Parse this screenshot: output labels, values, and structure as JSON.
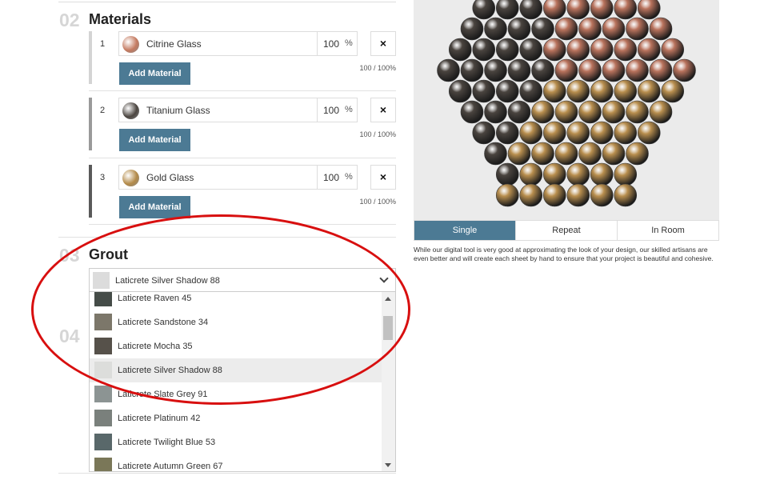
{
  "materials_section": {
    "number": "02",
    "title": "Materials",
    "rows": [
      {
        "index": "1",
        "name": "Citrine Glass",
        "percent": "100",
        "pct_symbol": "%",
        "remove": "×",
        "add_label": "Add Material",
        "total": "100 / 100%",
        "bar_color": "#d4d4d4",
        "swatch_color": "#c47a60"
      },
      {
        "index": "2",
        "name": "Titanium Glass",
        "percent": "100",
        "pct_symbol": "%",
        "remove": "×",
        "add_label": "Add Material",
        "total": "100 / 100%",
        "bar_color": "#9a9a9a",
        "swatch_color": "#4b4540"
      },
      {
        "index": "3",
        "name": "Gold Glass",
        "percent": "100",
        "pct_symbol": "%",
        "remove": "×",
        "add_label": "Add Material",
        "total": "100 / 100%",
        "bar_color": "#5a5a5a",
        "swatch_color": "#b38a48"
      }
    ]
  },
  "grout_section": {
    "number": "03",
    "title": "Grout",
    "selected": {
      "name": "Laticrete Silver Shadow 88",
      "color": "#dcdcdc"
    },
    "options": [
      {
        "name": "Laticrete Raven 45",
        "color": "#454c48",
        "selected": false
      },
      {
        "name": "Laticrete Sandstone 34",
        "color": "#7c776a",
        "selected": false
      },
      {
        "name": "Laticrete Mocha 35",
        "color": "#56514a",
        "selected": false
      },
      {
        "name": "Laticrete Silver Shadow 88",
        "color": "#dcdddb",
        "selected": true
      },
      {
        "name": "Laticrete Slate Grey 91",
        "color": "#8c9493",
        "selected": false
      },
      {
        "name": "Laticrete Platinum 42",
        "color": "#7a807c",
        "selected": false
      },
      {
        "name": "Laticrete Twilight Blue 53",
        "color": "#59686a",
        "selected": false
      },
      {
        "name": "Laticrete Autumn Green 67",
        "color": "#7a7758",
        "selected": false
      }
    ]
  },
  "next_section": {
    "number": "04"
  },
  "preview": {
    "background": "#ebebeb",
    "tile_colors": {
      "copper": "#b9735d",
      "titanium": "#4a443f",
      "gold": "#b98f4f"
    }
  },
  "view_tabs": [
    {
      "label": "Single",
      "active": true
    },
    {
      "label": "Repeat",
      "active": false
    },
    {
      "label": "In Room",
      "active": false
    }
  ],
  "disclaimer": "While our digital tool is very good at approximating the look of your design, our skilled artisans are even better and will create each sheet by hand to ensure that your project is beautiful and cohesive.",
  "annotation": {
    "color": "#d80f0f"
  }
}
